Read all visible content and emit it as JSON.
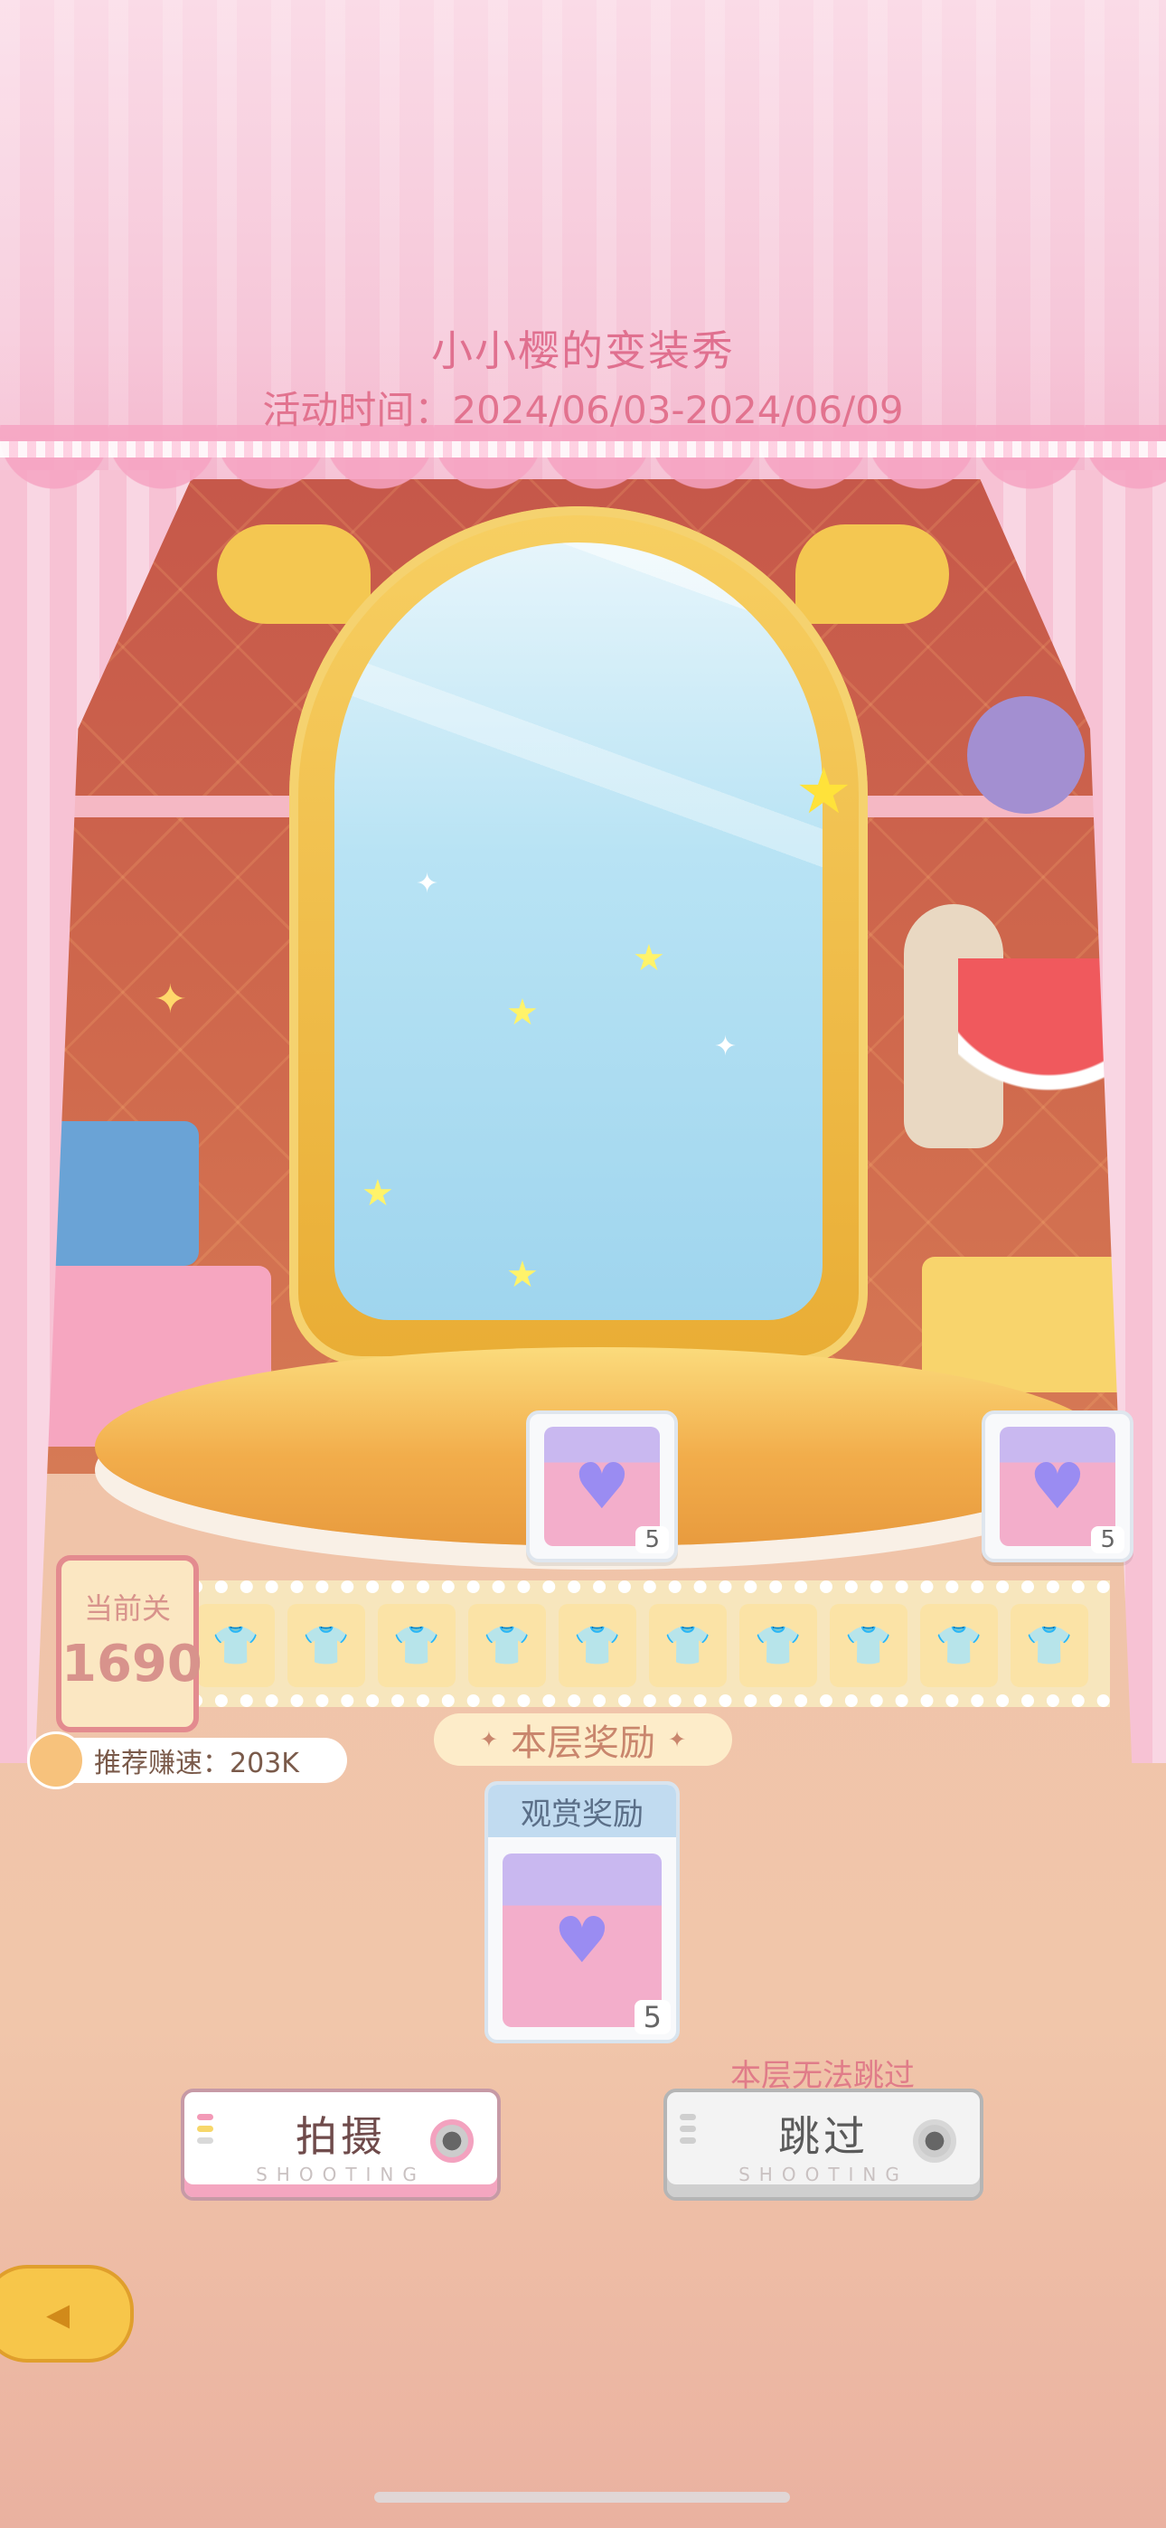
{
  "event": {
    "title": "小小樱的变装秀",
    "time": "活动时间：2024/06/03-2024/06/09"
  },
  "track": {
    "rewards": [
      {
        "icon": "gift-bag-icon",
        "quantity": "5"
      },
      {
        "icon": "gift-bag-icon",
        "quantity": "5"
      }
    ],
    "cells": [
      "shirt-icon",
      "shirt-icon",
      "shirt-icon",
      "shirt-icon",
      "shirt-icon",
      "shirt-icon",
      "shirt-icon",
      "shirt-icon",
      "shirt-icon",
      "shirt-icon"
    ]
  },
  "current_level": {
    "label": "当前关",
    "value": "1690"
  },
  "recommend_speed": {
    "text": "推荐赚速：203K"
  },
  "floor_reward": {
    "title": "本层奖励",
    "decoration": "✦"
  },
  "view_reward": {
    "title": "观赏奖励",
    "quantity": "5"
  },
  "actions": {
    "shoot_label": "拍摄",
    "shoot_sub": "SHOOTING",
    "skip_label": "跳过",
    "skip_sub": "SHOOTING",
    "cant_skip": "本层无法跳过"
  },
  "colors": {
    "accent_pink": "#e0708f",
    "gold": "#f4c751",
    "cream": "#fbe7c2"
  }
}
